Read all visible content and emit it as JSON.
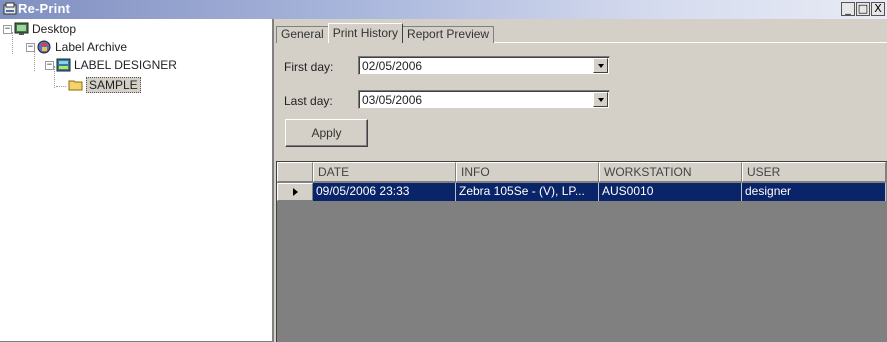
{
  "window": {
    "title": "Re-Print"
  },
  "title_buttons": {
    "minimize": "_",
    "maximize": "□",
    "close": "X"
  },
  "tree": [
    {
      "label": "Desktop",
      "expander": "−",
      "icon": "desktop-icon"
    },
    {
      "label": "Label Archive",
      "expander": "−",
      "icon": "archive-icon"
    },
    {
      "label": "LABEL DESIGNER",
      "expander": "−",
      "icon": "label-designer-icon"
    },
    {
      "label": "SAMPLE",
      "icon": "folder-icon",
      "selected": true
    }
  ],
  "tabs": [
    {
      "label": "General"
    },
    {
      "label": "Print History",
      "active": true
    },
    {
      "label": "Report Preview"
    }
  ],
  "filters": {
    "first_day": {
      "label": "First day:",
      "value": "02/05/2006"
    },
    "last_day": {
      "label": "Last day:",
      "value": "03/05/2006"
    }
  },
  "apply_button": "Apply",
  "grid": {
    "columns": [
      "DATE",
      "INFO",
      "WORKSTATION",
      "USER"
    ],
    "rows": [
      {
        "date": "09/05/2006 23:33",
        "info": "Zebra 105Se - (V), LP...",
        "workstation": "AUS0010",
        "user": "designer",
        "selected": true
      }
    ]
  },
  "colors": {
    "selection": "#0a246a",
    "face": "#d4d0c8",
    "grid_background": "#808080"
  }
}
